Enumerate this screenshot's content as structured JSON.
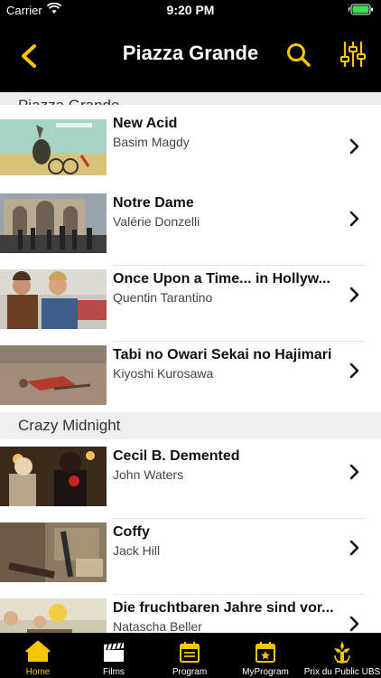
{
  "status_bar": {
    "carrier": "Carrier",
    "time": "9:20 PM"
  },
  "navbar": {
    "title": "Piazza Grande"
  },
  "sections": [
    {
      "title": "Piazza Grande"
    },
    {
      "title": "Crazy Midnight"
    }
  ],
  "films": [
    {
      "title": "New Acid",
      "director": "Basim Magdy"
    },
    {
      "title": "Notre Dame",
      "director": "Valérie Donzelli"
    },
    {
      "title": "Once Upon a Time... in Hollyw...",
      "director": "Quentin Tarantino"
    },
    {
      "title": "Tabi no Owari Sekai no Hajimari",
      "director": "Kiyoshi Kurosawa"
    },
    {
      "title": "Cecil B. Demented",
      "director": "John Waters"
    },
    {
      "title": "Coffy",
      "director": "Jack Hill"
    },
    {
      "title": "Die fruchtbaren Jahre sind vor...",
      "director": "Natascha Beller"
    }
  ],
  "tabs": [
    {
      "label": "Home",
      "icon": "home-icon"
    },
    {
      "label": "Films",
      "icon": "clapperboard-icon"
    },
    {
      "label": "Program",
      "icon": "calendar-icon"
    },
    {
      "label": "MyProgram",
      "icon": "calendar-star-icon"
    },
    {
      "label": "Prix du Public UBS",
      "icon": "award-icon"
    }
  ],
  "colors": {
    "accent": "#f5c500",
    "background": "#000000",
    "section": "#efefef"
  }
}
